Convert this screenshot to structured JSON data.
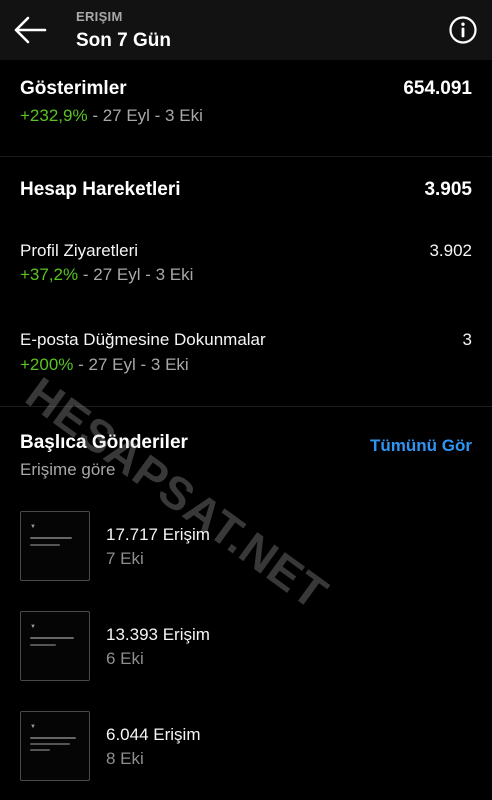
{
  "header": {
    "kicker": "ERIŞIM",
    "title": "Son 7 Gün"
  },
  "impressions": {
    "label": "Gösterimler",
    "value": "654.091",
    "change": "+232,9%",
    "range": " - 27 Eyl - 3 Eki"
  },
  "account_activity": {
    "label": "Hesap Hareketleri",
    "value": "3.905",
    "items": [
      {
        "label": "Profil Ziyaretleri",
        "value": "3.902",
        "change": "+37,2%",
        "range": " - 27 Eyl - 3 Eki"
      },
      {
        "label": "E-posta Düğmesine Dokunmalar",
        "value": "3",
        "change": "+200%",
        "range": " - 27 Eyl - 3 Eki"
      }
    ]
  },
  "top_posts": {
    "title": "Başlıca Gönderiler",
    "subtitle": "Erişime göre",
    "see_all": "Tümünü Gör",
    "posts": [
      {
        "count": "17.717 Erişim",
        "date": "7 Eki"
      },
      {
        "count": "13.393 Erişim",
        "date": "6 Eki"
      },
      {
        "count": "6.044 Erişim",
        "date": "8 Eki"
      }
    ]
  },
  "watermark": "HESAPSAT.NET",
  "icons": {
    "back": "arrow-left-icon",
    "info": "info-circle-icon"
  }
}
